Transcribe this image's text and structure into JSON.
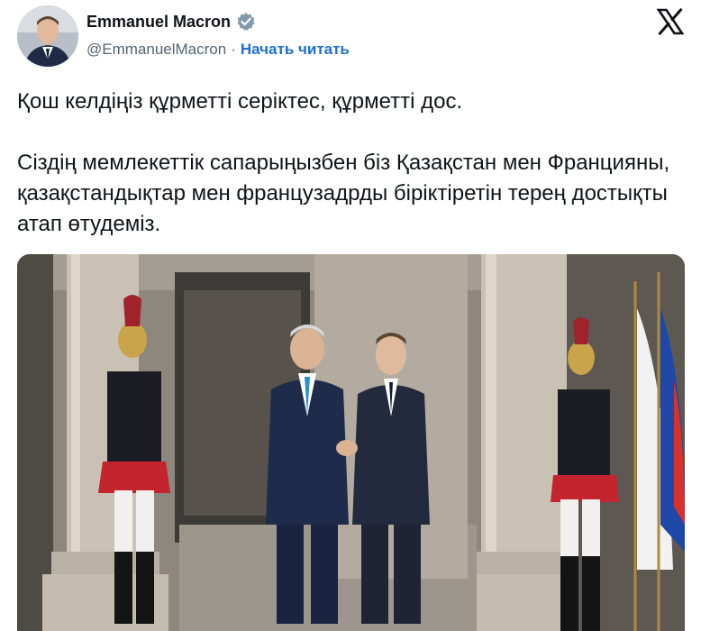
{
  "author": {
    "name": "Emmanuel Macron",
    "handle": "@EmmanuelMacron",
    "separator": "·",
    "follow_label": "Начать читать",
    "verified": true
  },
  "tweet": {
    "paragraph1": "Қош келдіңіз құрметті серіктес, құрметті дос.",
    "paragraph2": "Сіздің мемлекеттік сапарыңызбен біз Қазақстан мен Францияны, қазақстандықтар мен французадрды біріктіретін терең достықты атап өтудеміз."
  },
  "colors": {
    "text": "#0f1419",
    "secondary": "#536471",
    "link": "#1d6fd1",
    "verified_badge": "#829aab"
  },
  "icons": {
    "platform": "x-logo-icon",
    "badge": "verified-badge-icon"
  }
}
